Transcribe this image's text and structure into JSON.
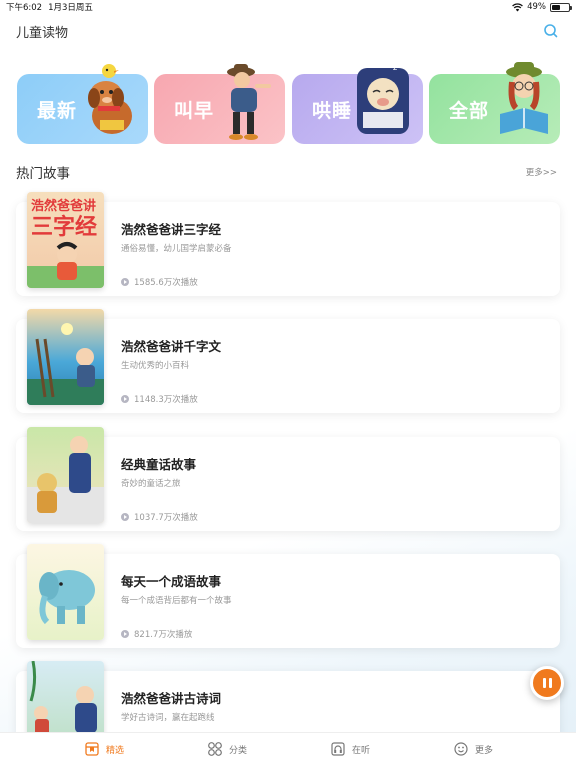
{
  "status_bar": {
    "time": "下午6:02",
    "date": "1月3日周五",
    "battery": "49%",
    "battery_level": 0.49
  },
  "header": {
    "title": "儿童读物",
    "search_icon": "search-icon"
  },
  "categories": [
    {
      "label": "最新",
      "color": "#8dcdf8"
    },
    {
      "label": "叫早",
      "color": "#f7a7b0"
    },
    {
      "label": "哄睡",
      "color": "#b7a9ee"
    },
    {
      "label": "全部",
      "color": "#93e29e"
    }
  ],
  "hot_section": {
    "title": "热门故事",
    "more": "更多>>"
  },
  "stories": [
    {
      "title": "浩然爸爸讲三字经",
      "desc": "通俗易懂，幼儿国学启蒙必备",
      "plays": "1585.6万次播放",
      "cover_text": "浩然爸爸讲三字经"
    },
    {
      "title": "浩然爸爸讲千字文",
      "desc": "生动优秀的小百科",
      "plays": "1148.3万次播放"
    },
    {
      "title": "经典童话故事",
      "desc": "奇妙的童话之旅",
      "plays": "1037.7万次播放"
    },
    {
      "title": "每天一个成语故事",
      "desc": "每一个成语背后都有一个故事",
      "plays": "821.7万次播放"
    },
    {
      "title": "浩然爸爸讲古诗词",
      "desc": "学好古诗词，赢在起跑线",
      "plays": ""
    }
  ],
  "tabbar": [
    {
      "label": "精选",
      "icon": "book-icon",
      "active": true
    },
    {
      "label": "分类",
      "icon": "grid-icon",
      "active": false
    },
    {
      "label": "在听",
      "icon": "headphone-book-icon",
      "active": false
    },
    {
      "label": "更多",
      "icon": "smile-icon",
      "active": false
    }
  ],
  "colors": {
    "accent": "#f07a1e",
    "text_primary": "#222222",
    "text_secondary": "#999999"
  }
}
